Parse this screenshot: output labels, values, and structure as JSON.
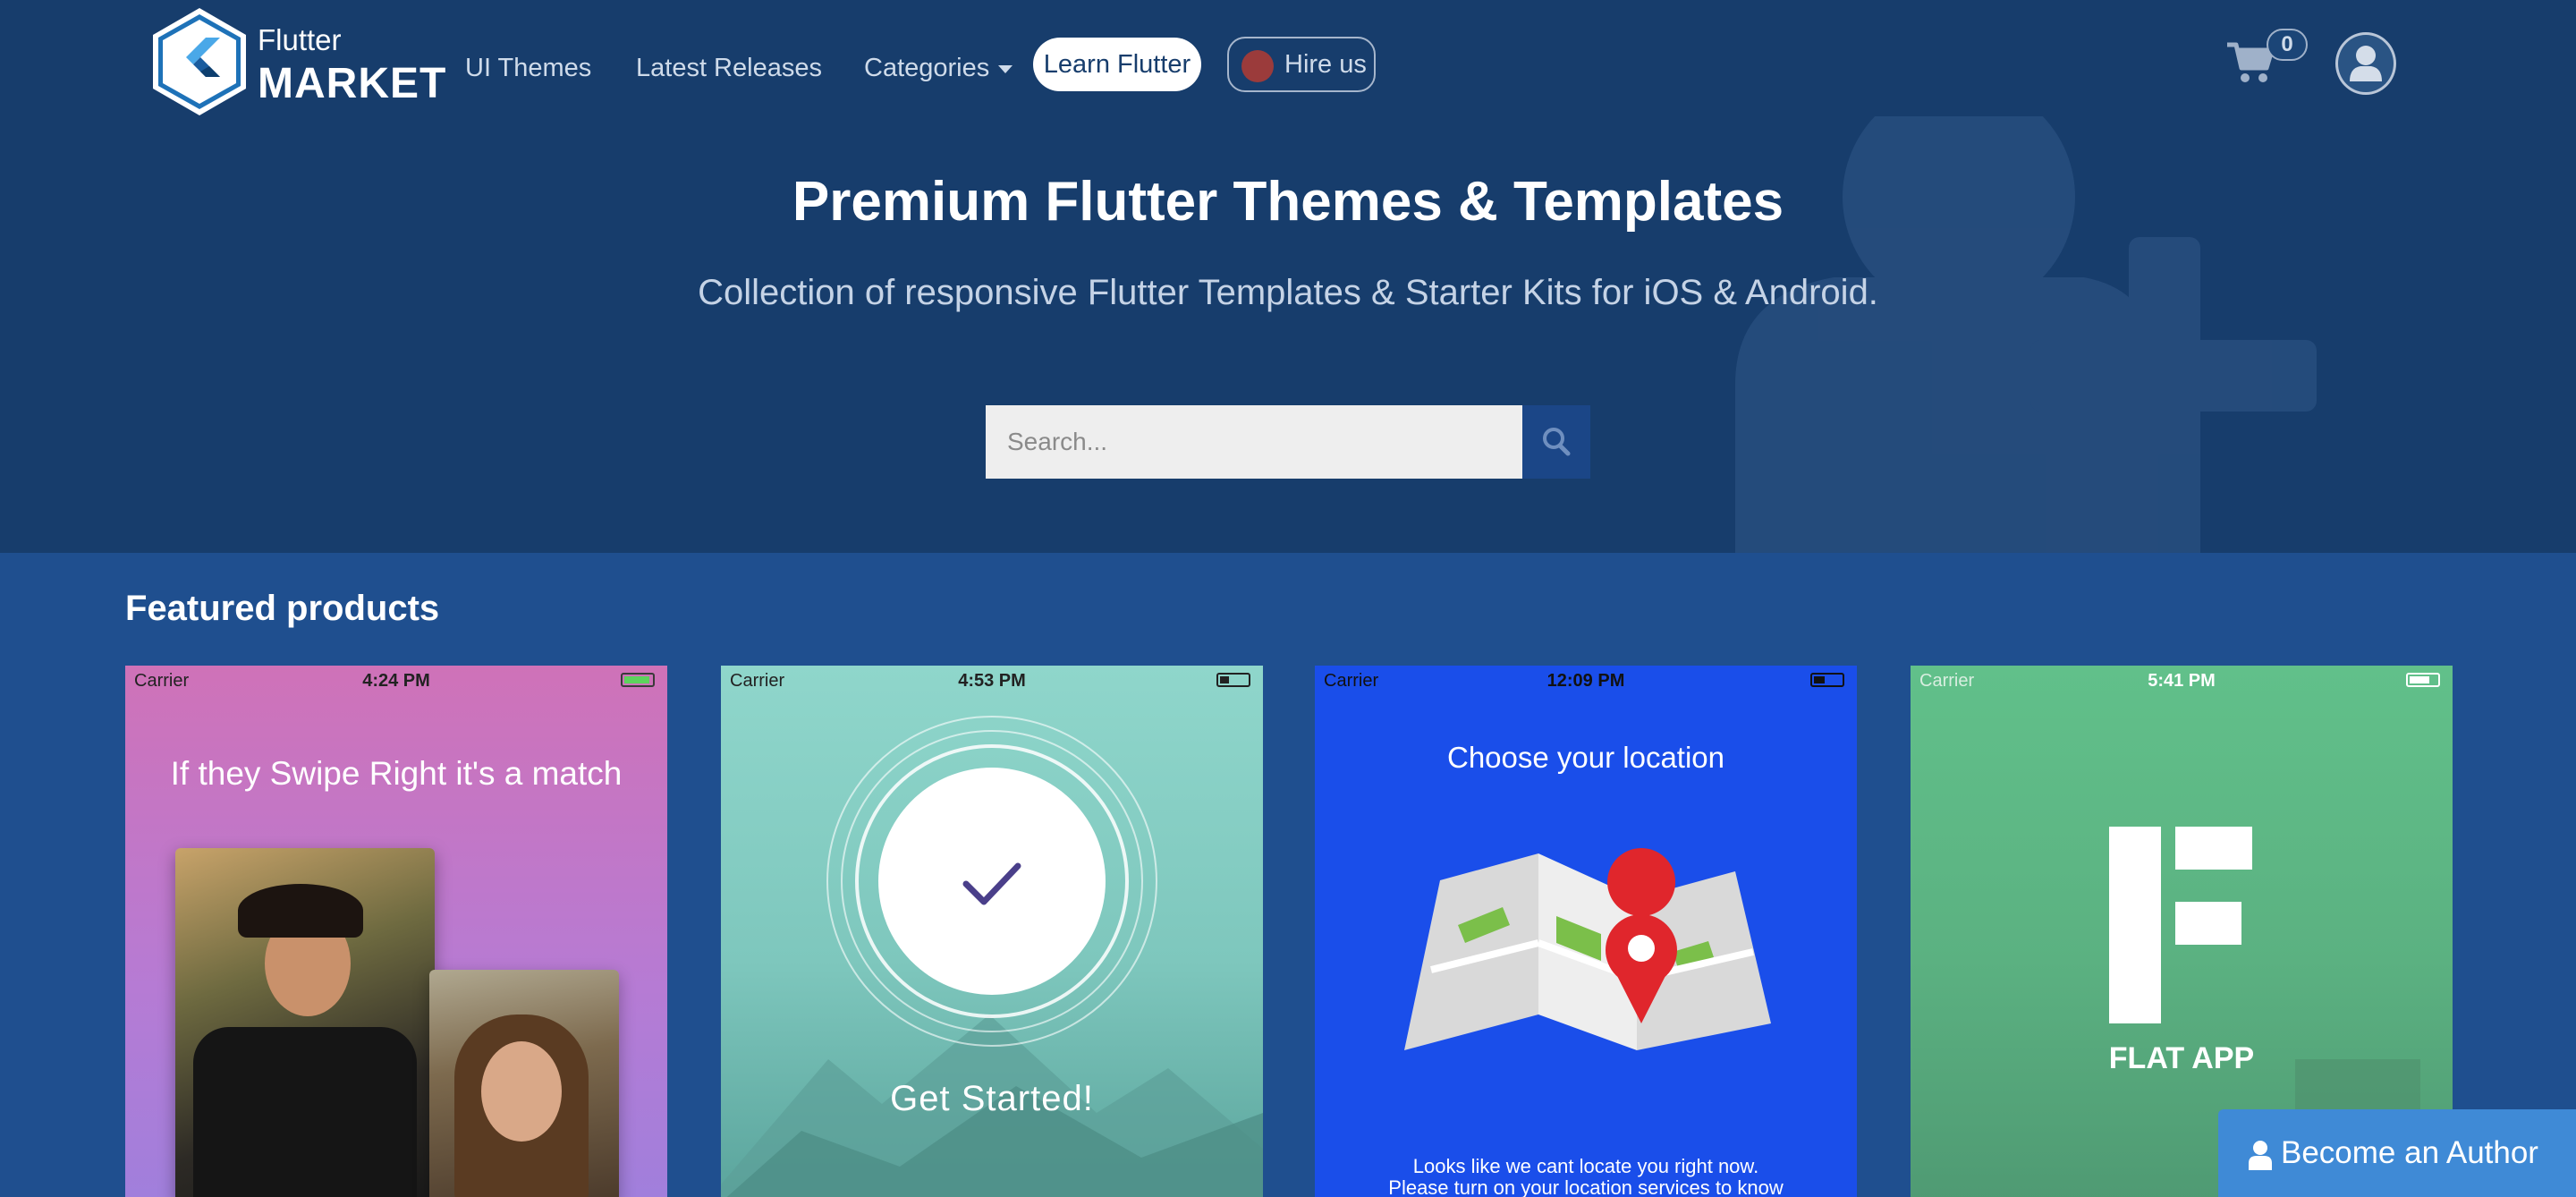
{
  "brand": {
    "line1": "Flutter",
    "line2": "MARKET"
  },
  "nav": {
    "ui_themes": "UI Themes",
    "latest_releases": "Latest Releases",
    "categories": "Categories",
    "learn_flutter": "Learn Flutter",
    "hire_us": "Hire us"
  },
  "cart": {
    "count": "0",
    "icon": "cart-icon"
  },
  "user": {
    "icon": "user-icon"
  },
  "hero": {
    "title": "Premium Flutter Themes & Templates",
    "subtitle": "Collection of responsive Flutter Templates & Starter Kits for iOS & Android.",
    "search_placeholder": "Search..."
  },
  "featured": {
    "title": "Featured products",
    "cards": [
      {
        "carrier": "Carrier",
        "time": "4:24 PM",
        "headline": "If they Swipe Right it's a match"
      },
      {
        "carrier": "Carrier",
        "time": "4:53 PM",
        "label": "Get Started!"
      },
      {
        "carrier": "Carrier",
        "time": "12:09 PM",
        "headline": "Choose your location",
        "footer1": "Looks like we cant locate you right now.",
        "footer2": "Please turn on your location services to know"
      },
      {
        "carrier": "Carrier",
        "time": "5:41 PM",
        "label": "FLAT APP"
      }
    ]
  },
  "author_button": "Become an Author",
  "colors": {
    "hero_bg": "#173d6c",
    "section_bg": "#1f4f8f",
    "search_button": "#1b4687",
    "author_button": "#3f8ad6"
  }
}
